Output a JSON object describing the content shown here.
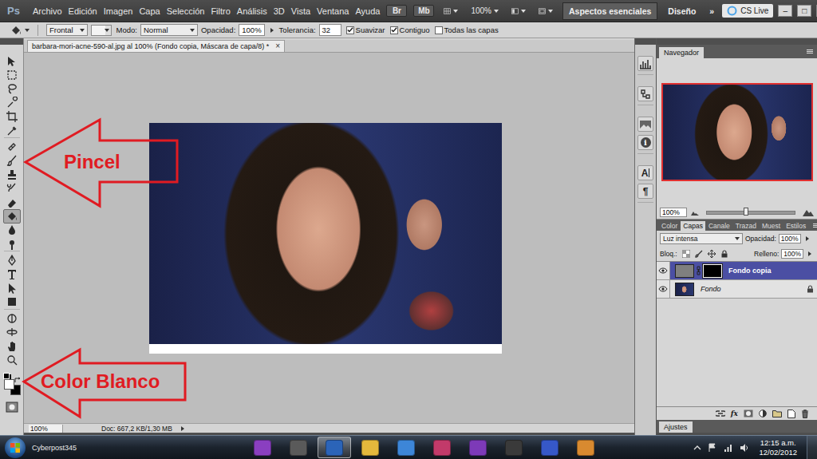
{
  "menubar": {
    "logo": "Ps",
    "menus": [
      "Archivo",
      "Edición",
      "Imagen",
      "Capa",
      "Selección",
      "Filtro",
      "Análisis",
      "3D",
      "Vista",
      "Ventana",
      "Ayuda"
    ],
    "bridge": "Br",
    "mini_bridge": "Mb",
    "zoom": "100%",
    "workspaces": [
      {
        "label": "Aspectos esenciales",
        "selected": true
      },
      {
        "label": "Diseño",
        "selected": false
      }
    ],
    "more": "»",
    "cs_live": "CS Live",
    "window_controls": [
      "–",
      "□",
      "×"
    ]
  },
  "options_bar": {
    "fill_source": "Frontal",
    "mode_label": "Modo:",
    "mode": "Normal",
    "opacity_label": "Opacidad:",
    "opacity": "100%",
    "tolerance_label": "Tolerancia:",
    "tolerance": "32",
    "checkboxes": [
      {
        "label": "Suavizar",
        "checked": true
      },
      {
        "label": "Contiguo",
        "checked": true
      },
      {
        "label": "Todas las capas",
        "checked": false
      }
    ]
  },
  "toolbox": {
    "tools": [
      {
        "selected": false
      },
      {
        "selected": false
      },
      {
        "selected": false
      },
      {
        "selected": false
      },
      {
        "selected": false
      },
      {
        "selected": false
      },
      {
        "selected": false
      },
      {
        "selected": false
      },
      {
        "selected": false
      },
      {
        "selected": false
      },
      {
        "selected": false
      },
      {
        "selected": true
      },
      {
        "selected": false
      },
      {
        "selected": false
      },
      {
        "selected": false
      },
      {
        "selected": false
      },
      {
        "selected": false
      },
      {
        "selected": false
      },
      {
        "selected": false
      },
      {
        "selected": false
      },
      {
        "selected": false
      },
      {
        "selected": false
      }
    ],
    "swatches": [
      {
        "color": "#ffffff"
      },
      {
        "color": "#000000"
      }
    ]
  },
  "document": {
    "tab": "barbara-mori-acne-590-al.jpg al 100% (Fondo copia, Máscara de capa/8) *",
    "close": "×",
    "zoom": "100%",
    "info": "Doc: 667,2 KB/1,30 MB"
  },
  "dock": {
    "info": "i",
    "character": "A",
    "paragraph": "¶"
  },
  "navigator": {
    "title": "Navegador",
    "zoom": "100%",
    "level": 0.45
  },
  "layers_panel": {
    "tabs": [
      {
        "label": "Color",
        "selected": false
      },
      {
        "label": "Capas",
        "selected": true
      },
      {
        "label": "Canale",
        "selected": false
      },
      {
        "label": "Trazad",
        "selected": false
      },
      {
        "label": "Muest",
        "selected": false
      },
      {
        "label": "Estilos",
        "selected": false
      }
    ],
    "blend_mode": "Luz intensa",
    "opacity_label": "Opacidad:",
    "opacity": "100%",
    "lock_label": "Bloq.:",
    "fill_label": "Relleno:",
    "fill": "100%",
    "layers": [
      {
        "name": "Fondo copia",
        "selected": true,
        "visible": true,
        "has_mask": true,
        "locked": false
      },
      {
        "name": "Fondo",
        "selected": false,
        "visible": true,
        "has_mask": false,
        "locked": true
      }
    ],
    "fx": "fx"
  },
  "adjustments": {
    "title": "Ajustes"
  },
  "taskbar": {
    "user": "Cyberpost345",
    "apps": [
      {
        "selected": false
      },
      {
        "selected": false
      },
      {
        "selected": true
      },
      {
        "selected": false
      },
      {
        "selected": false
      },
      {
        "selected": false
      },
      {
        "selected": false
      },
      {
        "selected": false
      },
      {
        "selected": false
      },
      {
        "selected": false
      }
    ],
    "time": "12:15 a.m.",
    "date": "12/02/2012"
  },
  "annotations": [
    {
      "label": "Pincel"
    },
    {
      "label": "Color Blanco"
    }
  ]
}
